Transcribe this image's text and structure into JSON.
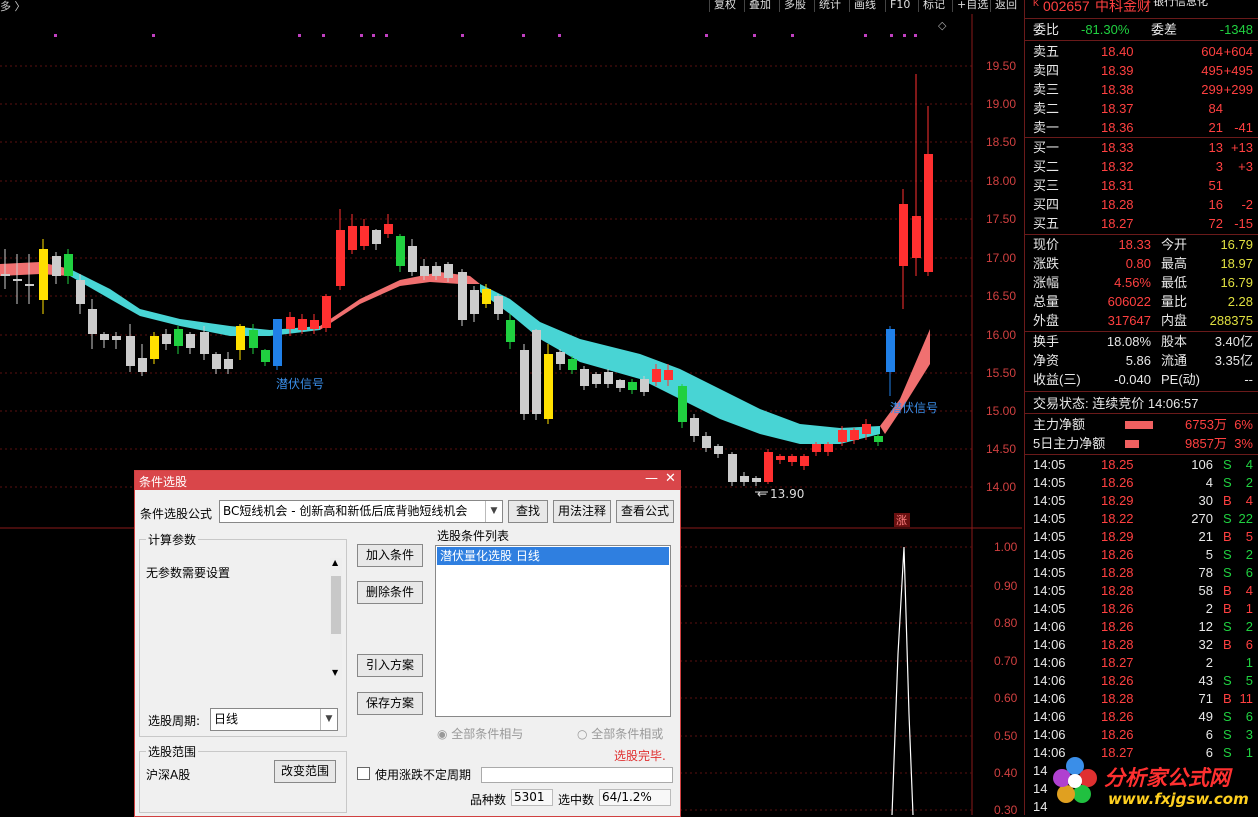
{
  "toolbar": {
    "left_text": "多 〉",
    "buttons": [
      "复权",
      "叠加",
      "多股",
      "统计",
      "画线",
      "F10",
      "标记",
      "+自选",
      "返回"
    ]
  },
  "chart": {
    "price_axis": [
      "19.50",
      "19.00",
      "18.50",
      "18.00",
      "17.50",
      "17.00",
      "16.50",
      "16.00",
      "15.50",
      "15.00",
      "14.50",
      "14.00"
    ],
    "sub_axis": [
      "1.00",
      "0.90",
      "0.80",
      "0.70",
      "0.60",
      "0.50",
      "0.40",
      "0.30"
    ],
    "signal_label_1": "潜伏信号",
    "signal_label_2": "潜伏信号",
    "low_marker": "13.90",
    "zhang_tag": "涨"
  },
  "quote": {
    "code": "002657",
    "name": "中科金财",
    "tag": "银行信息化",
    "webi_label": "委比",
    "webi_value": "-81.30%",
    "weicha_label": "委差",
    "weicha_value": "-1348",
    "asks": [
      {
        "label": "卖五",
        "price": "18.40",
        "vol": "604",
        "chg": "+604"
      },
      {
        "label": "卖四",
        "price": "18.39",
        "vol": "495",
        "chg": "+495"
      },
      {
        "label": "卖三",
        "price": "18.38",
        "vol": "299",
        "chg": "+299"
      },
      {
        "label": "卖二",
        "price": "18.37",
        "vol": "84",
        "chg": ""
      },
      {
        "label": "卖一",
        "price": "18.36",
        "vol": "21",
        "chg": "-41"
      }
    ],
    "bids": [
      {
        "label": "买一",
        "price": "18.33",
        "vol": "13",
        "chg": "+13"
      },
      {
        "label": "买二",
        "price": "18.32",
        "vol": "3",
        "chg": "+3"
      },
      {
        "label": "买三",
        "price": "18.31",
        "vol": "51",
        "chg": ""
      },
      {
        "label": "买四",
        "price": "18.28",
        "vol": "16",
        "chg": "-2"
      },
      {
        "label": "买五",
        "price": "18.27",
        "vol": "72",
        "chg": "-15"
      }
    ],
    "stats": [
      {
        "l1": "现价",
        "v1": "18.33",
        "l2": "今开",
        "v2": "16.79"
      },
      {
        "l1": "涨跌",
        "v1": "0.80",
        "l2": "最高",
        "v2": "18.97"
      },
      {
        "l1": "涨幅",
        "v1": "4.56%",
        "l2": "最低",
        "v2": "16.79"
      },
      {
        "l1": "总量",
        "v1": "606022",
        "l2": "量比",
        "v2": "2.28"
      },
      {
        "l1": "外盘",
        "v1": "317647",
        "l2": "内盘",
        "v2": "288375"
      }
    ],
    "stats2": [
      {
        "l1": "换手",
        "v1": "18.08%",
        "l2": "股本",
        "v2": "3.40亿"
      },
      {
        "l1": "净资",
        "v1": "5.86",
        "l2": "流通",
        "v2": "3.35亿"
      },
      {
        "l1": "收益(三)",
        "v1": "-0.040",
        "l2": "PE(动)",
        "v2": "--"
      }
    ],
    "trade_status": "交易状态: 连续竞价 14:06:57",
    "main_flow": [
      {
        "label": "主力净额",
        "value": "6753万",
        "pct": "6%"
      },
      {
        "label": "5日主力净额",
        "value": "9857万",
        "pct": "3%"
      }
    ],
    "ticks": [
      {
        "t": "14:05",
        "p": "18.25",
        "v": "106",
        "d": "S",
        "n": "4"
      },
      {
        "t": "14:05",
        "p": "18.26",
        "v": "4",
        "d": "S",
        "n": "2"
      },
      {
        "t": "14:05",
        "p": "18.29",
        "v": "30",
        "d": "B",
        "n": "4"
      },
      {
        "t": "14:05",
        "p": "18.22",
        "v": "270",
        "d": "S",
        "n": "22"
      },
      {
        "t": "14:05",
        "p": "18.29",
        "v": "21",
        "d": "B",
        "n": "5"
      },
      {
        "t": "14:05",
        "p": "18.26",
        "v": "5",
        "d": "S",
        "n": "2"
      },
      {
        "t": "14:05",
        "p": "18.28",
        "v": "78",
        "d": "S",
        "n": "6"
      },
      {
        "t": "14:05",
        "p": "18.28",
        "v": "58",
        "d": "B",
        "n": "4"
      },
      {
        "t": "14:05",
        "p": "18.26",
        "v": "2",
        "d": "B",
        "n": "1"
      },
      {
        "t": "14:06",
        "p": "18.26",
        "v": "12",
        "d": "S",
        "n": "2"
      },
      {
        "t": "14:06",
        "p": "18.28",
        "v": "32",
        "d": "B",
        "n": "6"
      },
      {
        "t": "14:06",
        "p": "18.27",
        "v": "2",
        "d": "",
        "n": "1"
      },
      {
        "t": "14:06",
        "p": "18.26",
        "v": "43",
        "d": "S",
        "n": "5"
      },
      {
        "t": "14:06",
        "p": "18.28",
        "v": "71",
        "d": "B",
        "n": "11"
      },
      {
        "t": "14:06",
        "p": "18.26",
        "v": "49",
        "d": "S",
        "n": "6"
      },
      {
        "t": "14:06",
        "p": "18.26",
        "v": "6",
        "d": "S",
        "n": "3"
      },
      {
        "t": "14:06",
        "p": "18.27",
        "v": "6",
        "d": "S",
        "n": "1"
      },
      {
        "t": "14",
        "p": "",
        "v": "",
        "d": "",
        "n": ""
      },
      {
        "t": "14",
        "p": "",
        "v": "",
        "d": "",
        "n": ""
      },
      {
        "t": "14",
        "p": "",
        "v": "",
        "d": "",
        "n": ""
      }
    ]
  },
  "dialog": {
    "title": "条件选股",
    "formula_label": "条件选股公式",
    "formula_value": "BC短线机会 - 创新高和新低后底背驰短线机会",
    "find_btn": "查找",
    "usage_btn": "用法注释",
    "view_btn": "查看公式",
    "calc_params_legend": "计算参数",
    "no_params": "无参数需要设置",
    "period_label": "选股周期:",
    "period_value": "日线",
    "range_legend": "选股范围",
    "range_value": "沪深A股",
    "change_range_btn": "改变范围",
    "add_btn": "加入条件",
    "delete_btn": "删除条件",
    "import_btn": "引入方案",
    "save_btn": "保存方案",
    "list_label": "选股条件列表",
    "list_items": [
      "潜伏量化选股  日线"
    ],
    "radio_and": "全部条件相与",
    "radio_or": "全部条件相或",
    "done_text": "选股完毕.",
    "use_checkbox": "使用涨跌不定周期",
    "count_label": "品种数",
    "count_value": "5301",
    "selected_label": "选中数",
    "selected_value": "64/1.2%"
  },
  "watermark": {
    "title": "分析家公式网",
    "url": "www.fxjgsw.com"
  },
  "colors": {
    "up": "#ff3030",
    "down": "#20d040",
    "band_up": "#f07070",
    "band_down": "#40d0d0",
    "dialog_title": "#d9464a"
  }
}
